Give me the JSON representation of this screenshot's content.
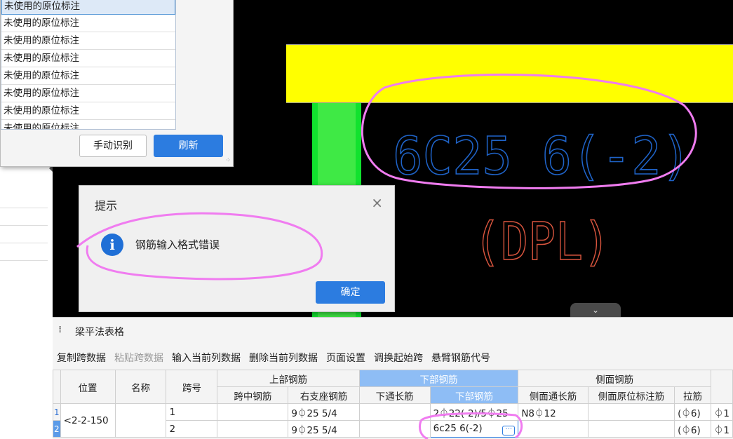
{
  "list_popup": {
    "items": [
      "未使用的原位标注",
      "未使用的原位标注",
      "未使用的原位标注",
      "未使用的原位标注",
      "未使用的原位标注",
      "未使用的原位标注",
      "未使用的原位标注",
      "未使用的原位标注"
    ],
    "manual_button": "手动识别",
    "refresh_button": "刷新"
  },
  "cad": {
    "rebar_text": "6C25 6(-2)",
    "beam_code_text": "(DPL)",
    "collapse_icon": "chevron-down-icon"
  },
  "dialog": {
    "title": "提示",
    "close_icon": "×",
    "info_icon": "i",
    "message": "钢筋输入格式错误",
    "ok_button": "确定"
  },
  "panel": {
    "title": "梁平法表格",
    "toolbar": [
      {
        "label": "复制跨数据",
        "enabled": true
      },
      {
        "label": "粘贴跨数据",
        "enabled": false
      },
      {
        "label": "输入当前列数据",
        "enabled": true
      },
      {
        "label": "删除当前列数据",
        "enabled": true
      },
      {
        "label": "页面设置",
        "enabled": true
      },
      {
        "label": "调换起始跨",
        "enabled": true
      },
      {
        "label": "悬臂钢筋代号",
        "enabled": true
      }
    ],
    "headers": {
      "position": "位置",
      "name": "名称",
      "span": "跨号",
      "top_group": "上部钢筋",
      "mid_span": "跨中钢筋",
      "right_support": "右支座钢筋",
      "bottom_group": "下部钢筋",
      "bottom_through": "下通长筋",
      "bottom_rebar": "下部钢筋",
      "side_group": "侧面钢筋",
      "side_through": "侧面通长筋",
      "side_original": "侧面原位标注筋",
      "tie": "拉筋"
    },
    "rows": [
      {
        "num": "1",
        "position": "<2-2-150",
        "name": "",
        "span": "1",
        "mid_span": "",
        "right_support": "9⏀25 5/4",
        "bottom_through": "",
        "bottom_rebar": "2⏀22(-2)/5⏀25",
        "side_through": "N8⏀12",
        "side_original": "",
        "tie": "(⏀6)",
        "extra": "⏀1"
      },
      {
        "num": "2",
        "position": "",
        "name": "",
        "span": "2",
        "mid_span": "",
        "right_support": "9⏀25 5/4",
        "bottom_through": "",
        "bottom_rebar": "6c25 6(-2)",
        "side_through": "",
        "side_original": "",
        "tie": "(⏀6)",
        "extra": "⏀1"
      }
    ],
    "more_icon": "···"
  }
}
